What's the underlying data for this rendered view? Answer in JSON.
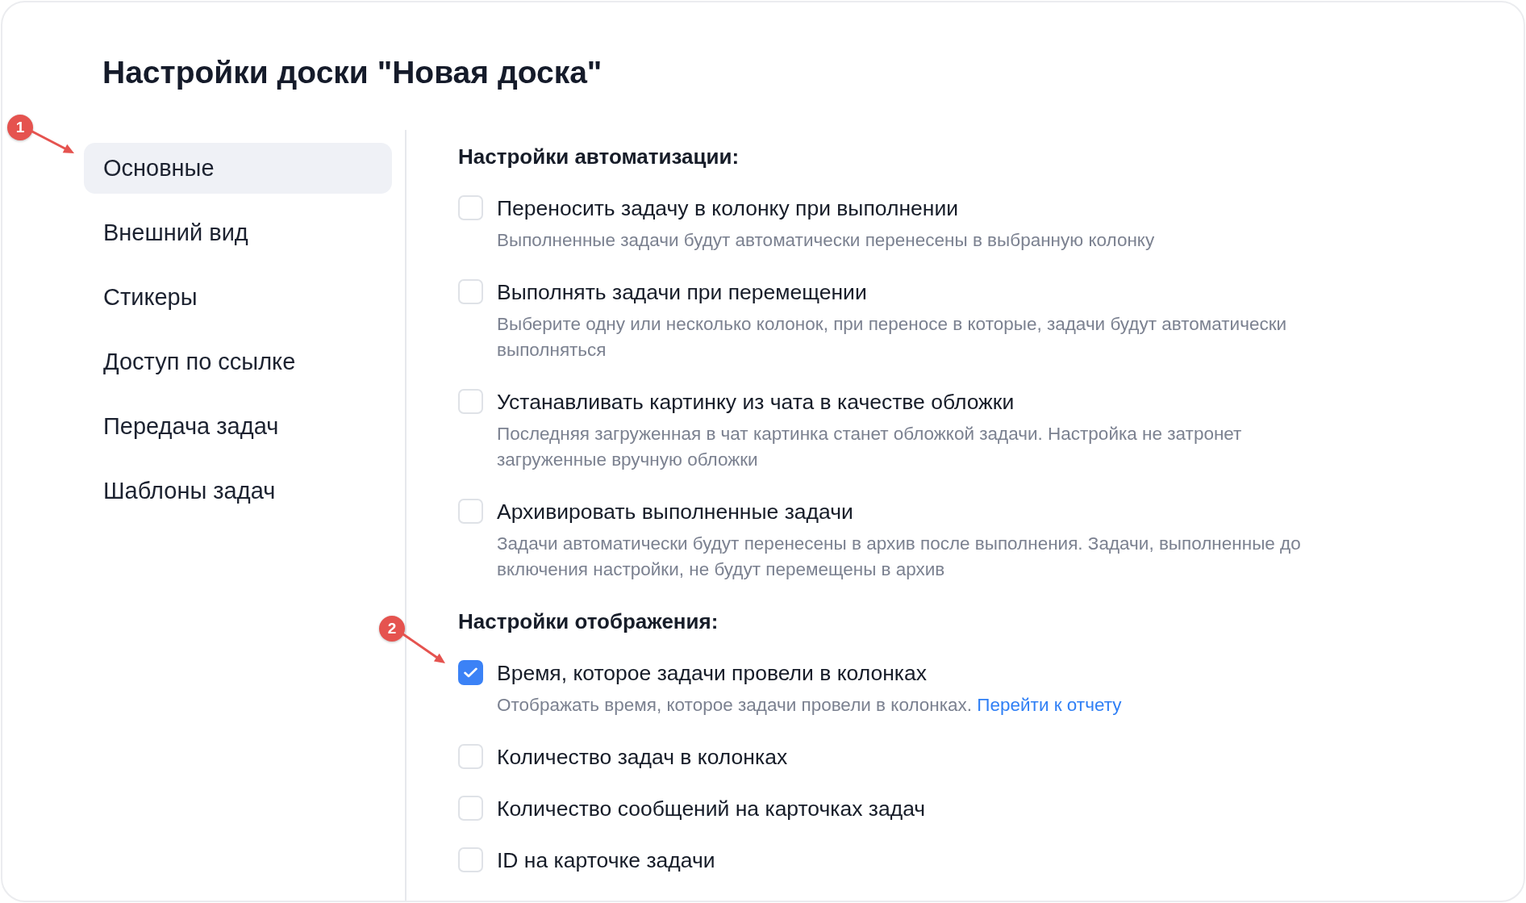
{
  "title": "Настройки доски \"Новая доска\"",
  "sidebar": {
    "items": [
      {
        "label": "Основные",
        "selected": true,
        "callout": "1"
      },
      {
        "label": "Внешний вид",
        "selected": false
      },
      {
        "label": "Стикеры",
        "selected": false
      },
      {
        "label": "Доступ по ссылке",
        "selected": false
      },
      {
        "label": "Передача задач",
        "selected": false
      },
      {
        "label": "Шаблоны задач",
        "selected": false
      }
    ]
  },
  "sections": [
    {
      "heading": "Настройки автоматизации:",
      "options": [
        {
          "label": "Переносить задачу в колонку при выполнении",
          "description": "Выполненные задачи будут автоматически перенесены в выбранную колонку",
          "checked": false
        },
        {
          "label": "Выполнять задачи при перемещении",
          "description": "Выберите одну или несколько колонок, при переносе в которые, задачи будут автоматически выполняться",
          "checked": false
        },
        {
          "label": "Устанавливать картинку из чата в качестве обложки",
          "description": "Последняя загруженная в чат картинка станет обложкой задачи. Настройка не затронет загруженные вручную обложки",
          "checked": false
        },
        {
          "label": "Архивировать выполненные задачи",
          "description": "Задачи автоматически будут перенесены в архив после выполнения. Задачи, выполненные до включения настройки, не будут перемещены в архив",
          "checked": false
        }
      ]
    },
    {
      "heading": "Настройки отображения:",
      "options": [
        {
          "label": "Время, которое задачи провели в колонках",
          "description": "Отображать время, которое задачи провели в колонках.",
          "link": "Перейти к отчету",
          "checked": true,
          "callout": "2"
        },
        {
          "label": "Количество задач в колонках",
          "checked": false
        },
        {
          "label": "Количество сообщений на карточках задач",
          "checked": false
        },
        {
          "label": "ID на карточке задачи",
          "checked": false
        }
      ]
    }
  ]
}
